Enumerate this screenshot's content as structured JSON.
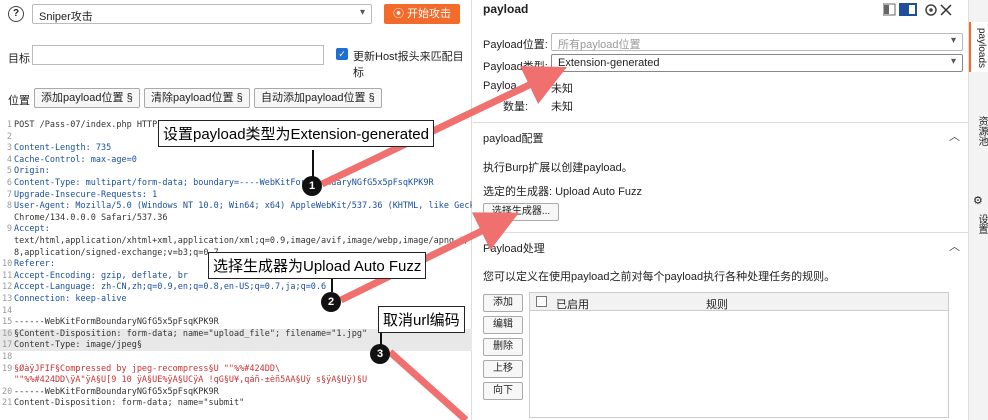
{
  "toolbar": {
    "attack_type": "Sniper攻击",
    "start_attack": "开始攻击"
  },
  "target": {
    "label": "目标",
    "host_header_checkbox": "更新Host报头来匹配目标"
  },
  "positions": {
    "label": "位置",
    "add_button": "添加payload位置 §",
    "clear_button": "清除payload位置 §",
    "auto_button": "自动添加payload位置 §"
  },
  "request_lines": [
    {
      "n": "1",
      "t": "POST /Pass-07/index.php HTTP/1.1"
    },
    {
      "n": "2",
      "t": ""
    },
    {
      "n": "3",
      "t": "Content-Length: 735"
    },
    {
      "n": "4",
      "t": "Cache-Control: max-age=0"
    },
    {
      "n": "5",
      "t": "Origin:"
    },
    {
      "n": "6",
      "t": "Content-Type: multipart/form-data; boundary=----WebKitFormBoundaryNGfG5x5pFsqKPK9R"
    },
    {
      "n": "7",
      "t": "Upgrade-Insecure-Requests: 1"
    },
    {
      "n": "8",
      "t": "User-Agent: Mozilla/5.0 (Windows NT 10.0; Win64; x64) AppleWebKit/537.36 (KHTML, like Gecko)"
    },
    {
      "n": "",
      "t": "Chrome/134.0.0.0 Safari/537.36"
    },
    {
      "n": "9",
      "t": "Accept:"
    },
    {
      "n": "",
      "t": "text/html,application/xhtml+xml,application/xml;q=0.9,image/avif,image/webp,image/apng,*/*"
    },
    {
      "n": "",
      "t": "8,application/signed-exchange;v=b3;q=0.7"
    },
    {
      "n": "10",
      "t": "Referer:"
    },
    {
      "n": "11",
      "t": "Accept-Encoding: gzip, deflate, br"
    },
    {
      "n": "12",
      "t": "Accept-Language: zh-CN,zh;q=0.9,en;q=0.8,en-US;q=0.7,ja;q=0.6"
    },
    {
      "n": "13",
      "t": "Connection: keep-alive"
    },
    {
      "n": "14",
      "t": ""
    },
    {
      "n": "15",
      "t": "------WebKitFormBoundaryNGfG5x5pFsqKPK9R"
    },
    {
      "n": "16",
      "t": "§Content-Disposition: form-data; name=\"upload_file\"; filename=\"1.jpg\""
    },
    {
      "n": "17",
      "t": "Content-Type: image/jpeg§"
    },
    {
      "n": "18",
      "t": ""
    },
    {
      "n": "19",
      "t": "§ØàÿJFIF§Compressed by jpeg-recompress§Û          \"\"%%#424DD\\"
    },
    {
      "n": "",
      "t": "\"\"%%#424DD\\ÿÄ\"ÿÃ§Û[9  10  ÿÄ§ÛE%ÿÄ§ÛCÿÄ !qG§Û¥,qáñ-±èñ5ÄÃ§Ûÿ  s§ÿÄ§Ûÿ)§Û"
    },
    {
      "n": "20",
      "t": "------WebKitFormBoundaryNGfG5x5pFsqKPK9R"
    },
    {
      "n": "21",
      "t": "Content-Disposition: form-data; name=\"submit\""
    }
  ],
  "callouts": {
    "c1": "设置payload类型为Extension-generated",
    "c2": "选择生成器为Upload Auto Fuzz",
    "c3": "取消url编码",
    "b1": "1",
    "b2": "2",
    "b3": "3"
  },
  "payload_panel": {
    "title": "payload",
    "position_label": "Payload位置:",
    "position_placeholder": "所有payload位置",
    "type_label": "Payload类型:",
    "type_value": "Extension-generated",
    "count_label": "Payloa",
    "count_value": "未知",
    "req_label": "数量:",
    "req_value": "未知",
    "config_title": "payload配置",
    "config_desc": "执行Burp扩展以创建payload。",
    "generator_label": "选定的生成器: Upload Auto Fuzz",
    "select_generator": "选择生成器...",
    "processing_title": "Payload处理",
    "processing_desc": "您可以定义在使用payload之前对每个payload执行各种处理任务的规则。",
    "btn_add": "添加",
    "btn_edit": "编辑",
    "btn_remove": "删除",
    "btn_up": "上移",
    "btn_down": "向下",
    "col_enabled": "已启用",
    "col_rule": "规则"
  },
  "rail": {
    "tab1": "payloads",
    "tab2": "资源池",
    "tab3": "设置"
  },
  "colors": {
    "accent": "#f26b2a",
    "arrow": "#f07070",
    "checkbox": "#1f6fd1"
  }
}
